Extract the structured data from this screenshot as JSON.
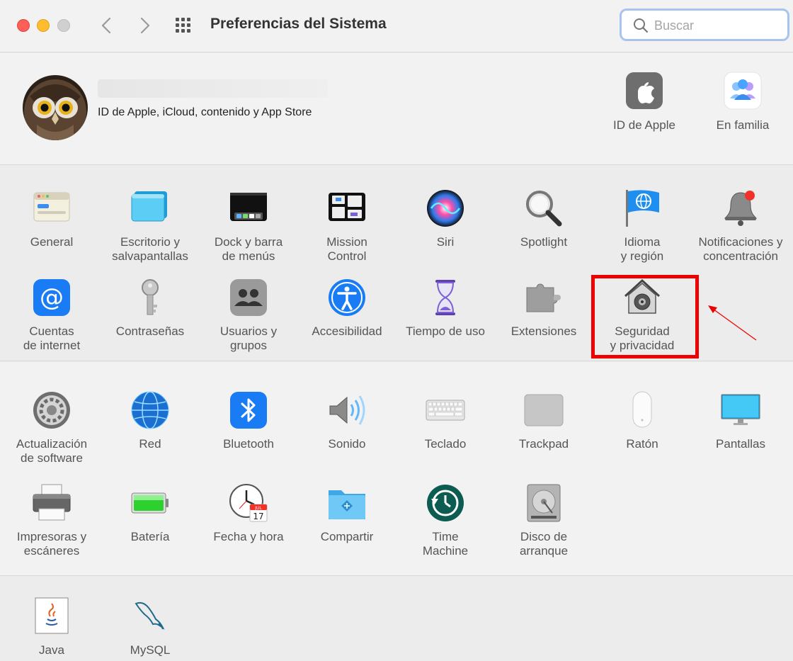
{
  "window": {
    "title": "Preferencias del Sistema",
    "search_placeholder": "Buscar"
  },
  "account": {
    "subtitle": "ID de Apple, iCloud, contenido y App Store",
    "buttons": [
      {
        "label": "ID de Apple",
        "icon": "apple-logo-icon"
      },
      {
        "label": "En familia",
        "icon": "family-icon"
      }
    ]
  },
  "section1": [
    {
      "label": "General",
      "icon": "general-icon"
    },
    {
      "label": "Escritorio y\nsalvapantallas",
      "icon": "desktop-icon"
    },
    {
      "label": "Dock y barra\nde menús",
      "icon": "dock-icon"
    },
    {
      "label": "Mission\nControl",
      "icon": "mission-control-icon"
    },
    {
      "label": "Siri",
      "icon": "siri-icon"
    },
    {
      "label": "Spotlight",
      "icon": "spotlight-icon"
    },
    {
      "label": "Idioma\ny región",
      "icon": "globe-flag-icon"
    },
    {
      "label": "Notificaciones y\nconcentración",
      "icon": "bell-icon"
    },
    {
      "label": "Cuentas\nde internet",
      "icon": "at-icon"
    },
    {
      "label": "Contraseñas",
      "icon": "key-icon"
    },
    {
      "label": "Usuarios y\ngrupos",
      "icon": "users-icon"
    },
    {
      "label": "Accesibilidad",
      "icon": "accessibility-icon"
    },
    {
      "label": "Tiempo de uso",
      "icon": "hourglass-icon"
    },
    {
      "label": "Extensiones",
      "icon": "puzzle-icon"
    },
    {
      "label": "Seguridad\ny privacidad",
      "icon": "security-house-icon"
    }
  ],
  "section2": [
    {
      "label": "Actualización\nde software",
      "icon": "gear-icon"
    },
    {
      "label": "Red",
      "icon": "network-globe-icon"
    },
    {
      "label": "Bluetooth",
      "icon": "bluetooth-icon"
    },
    {
      "label": "Sonido",
      "icon": "speaker-icon"
    },
    {
      "label": "Teclado",
      "icon": "keyboard-icon"
    },
    {
      "label": "Trackpad",
      "icon": "trackpad-icon"
    },
    {
      "label": "Ratón",
      "icon": "mouse-icon"
    },
    {
      "label": "Pantallas",
      "icon": "display-icon"
    },
    {
      "label": "Impresoras y\nescáneres",
      "icon": "printer-icon"
    },
    {
      "label": "Batería",
      "icon": "battery-icon"
    },
    {
      "label": "Fecha y hora",
      "icon": "clock-calendar-icon"
    },
    {
      "label": "Compartir",
      "icon": "shared-folder-icon"
    },
    {
      "label": "Time\nMachine",
      "icon": "time-machine-icon"
    },
    {
      "label": "Disco de\narranque",
      "icon": "hard-disk-icon"
    }
  ],
  "section3": [
    {
      "label": "Java",
      "icon": "java-icon"
    },
    {
      "label": "MySQL",
      "icon": "mysql-dolphin-icon"
    }
  ],
  "calendar_icon": {
    "month": "JUL",
    "day": "17"
  },
  "colors": {
    "highlight": "#ee0000",
    "accent": "#1a7cf5"
  }
}
